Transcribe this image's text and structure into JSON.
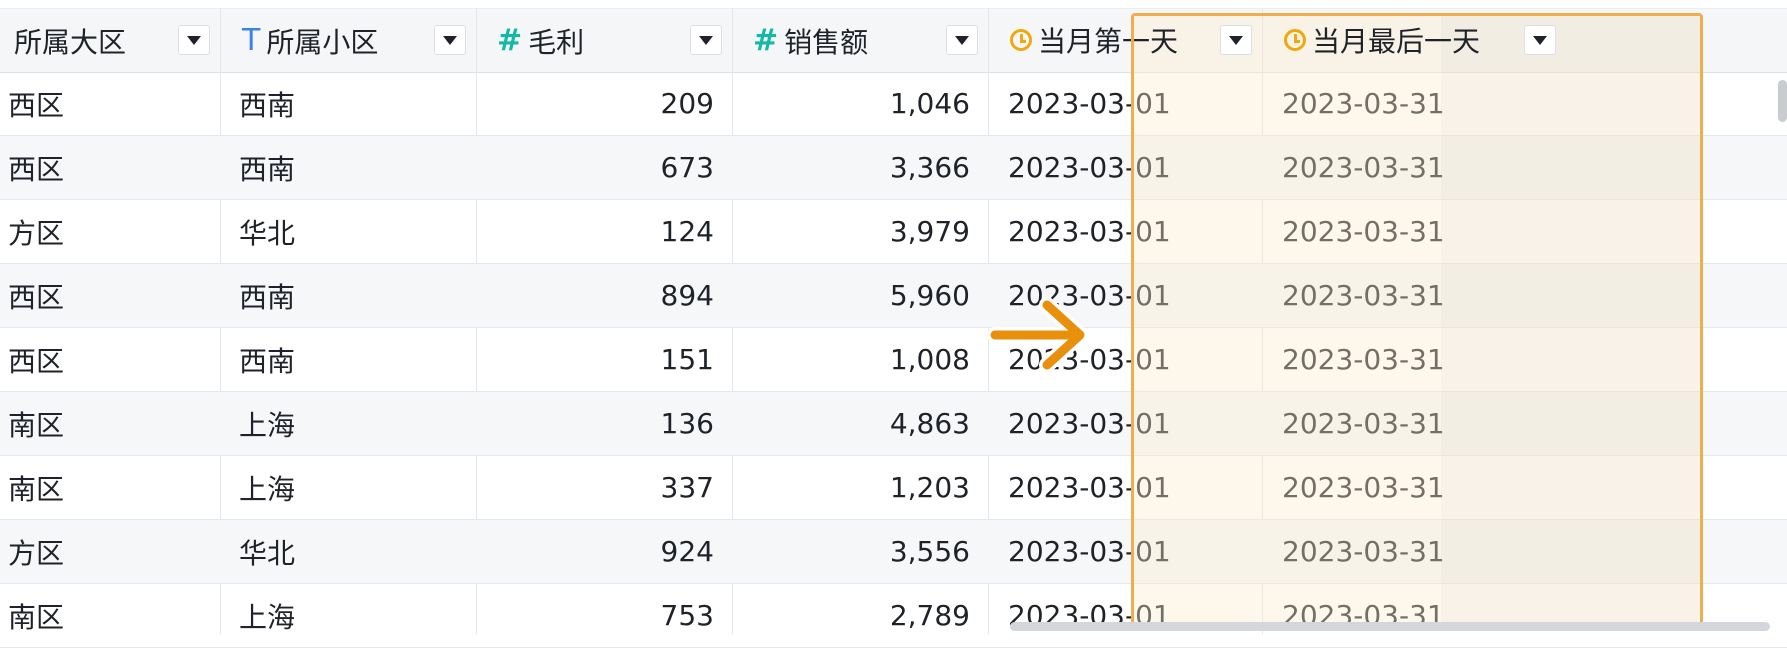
{
  "columns": [
    {
      "label": "所属大区",
      "type_icon": "",
      "icon_name": "none"
    },
    {
      "label": "所属小区",
      "type_icon": "T",
      "icon_name": "text-type-icon"
    },
    {
      "label": "毛利",
      "type_icon": "#",
      "icon_name": "number-type-icon"
    },
    {
      "label": "销售额",
      "type_icon": "#",
      "icon_name": "number-type-icon"
    },
    {
      "label": "当月第一天",
      "type_icon": "",
      "icon_name": "clock-icon"
    },
    {
      "label": "当月最后一天",
      "type_icon": "",
      "icon_name": "clock-icon"
    }
  ],
  "rows": [
    [
      "西区",
      "西南",
      "209",
      "1,046",
      "2023-03-01",
      "2023-03-31"
    ],
    [
      "西区",
      "西南",
      "673",
      "3,366",
      "2023-03-01",
      "2023-03-31"
    ],
    [
      "方区",
      "华北",
      "124",
      "3,979",
      "2023-03-01",
      "2023-03-31"
    ],
    [
      "西区",
      "西南",
      "894",
      "5,960",
      "2023-03-01",
      "2023-03-31"
    ],
    [
      "西区",
      "西南",
      "151",
      "1,008",
      "2023-03-01",
      "2023-03-31"
    ],
    [
      "南区",
      "上海",
      "136",
      "4,863",
      "2023-03-01",
      "2023-03-31"
    ],
    [
      "南区",
      "上海",
      "337",
      "1,203",
      "2023-03-01",
      "2023-03-31"
    ],
    [
      "方区",
      "华北",
      "924",
      "3,556",
      "2023-03-01",
      "2023-03-31"
    ],
    [
      "南区",
      "上海",
      "753",
      "2,789",
      "2023-03-01",
      "2023-03-31"
    ]
  ],
  "colors": {
    "text_type_icon": "#3b82e6",
    "number_type_icon": "#14b8a6",
    "date_type_icon": "#f0a80f",
    "highlight_border": "#f0ad4e",
    "arrow": "#e8900c"
  }
}
